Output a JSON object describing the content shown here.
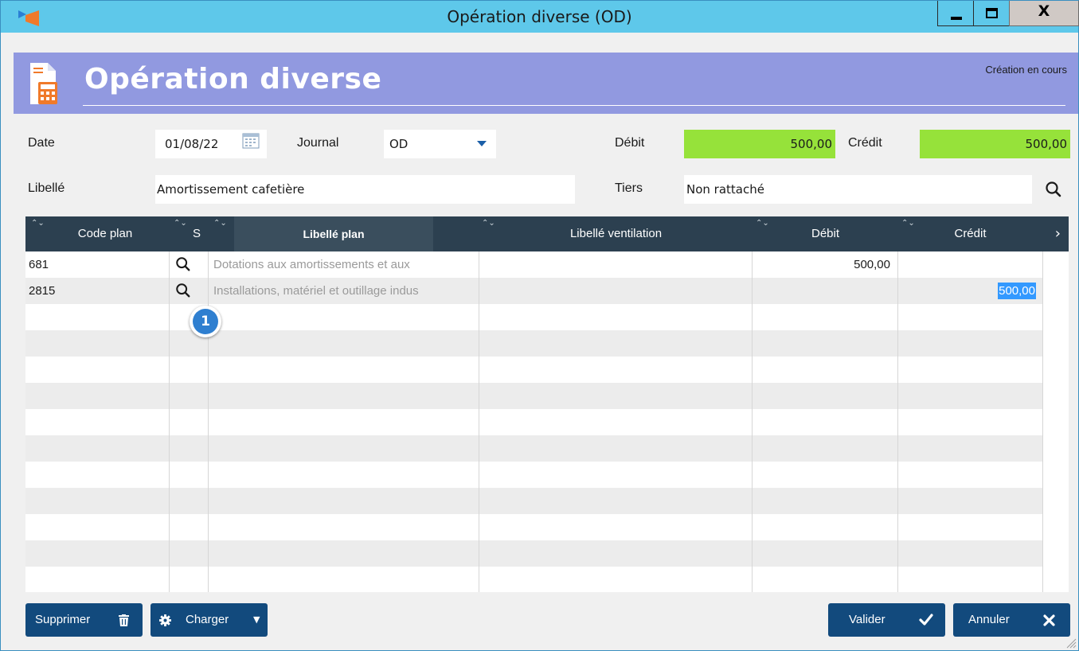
{
  "window": {
    "title": "Opération diverse (OD)",
    "close_label": "X"
  },
  "header": {
    "title": "Opération diverse",
    "status": "Création en cours"
  },
  "form": {
    "date_label": "Date",
    "date_value": "01/08/22",
    "journal_label": "Journal",
    "journal_value": "OD",
    "debit_label": "Débit",
    "debit_value": "500,00",
    "credit_label": "Crédit",
    "credit_value": "500,00",
    "libelle_label": "Libellé",
    "libelle_value": "Amortissement cafetière",
    "tiers_label": "Tiers",
    "tiers_value": "Non rattaché"
  },
  "grid": {
    "columns": [
      "Code plan",
      "S",
      "Libellé plan",
      "Libellé ventilation",
      "Débit",
      "Crédit"
    ],
    "rows": [
      {
        "code": "681",
        "libelle_plan": "Dotations aux amortissements et aux",
        "libelle_ventilation": "",
        "debit": "500,00",
        "credit": ""
      },
      {
        "code": "2815",
        "libelle_plan": "Installations, matériel et outillage indus",
        "libelle_ventilation": "",
        "debit": "",
        "credit": "500,00"
      }
    ]
  },
  "callout": {
    "label": "1"
  },
  "buttons": {
    "supprimer": "Supprimer",
    "charger": "Charger",
    "valider": "Valider",
    "annuler": "Annuler"
  },
  "colors": {
    "titlebar": "#5ec8ea",
    "header": "#9199e0",
    "total_fill": "#96e23a",
    "grid_header": "#2c4050",
    "button": "#124a7d",
    "selection": "#3399ff"
  },
  "icons": [
    "app-logo-icon",
    "minimize-icon",
    "maximize-icon",
    "close-icon",
    "calculator-document-icon",
    "calendar-icon",
    "dropdown-arrow-icon",
    "search-icon",
    "sort-icon",
    "chevron-right-icon",
    "trash-icon",
    "gear-icon",
    "caret-down-icon",
    "check-icon",
    "x-icon",
    "resize-grip-icon"
  ]
}
